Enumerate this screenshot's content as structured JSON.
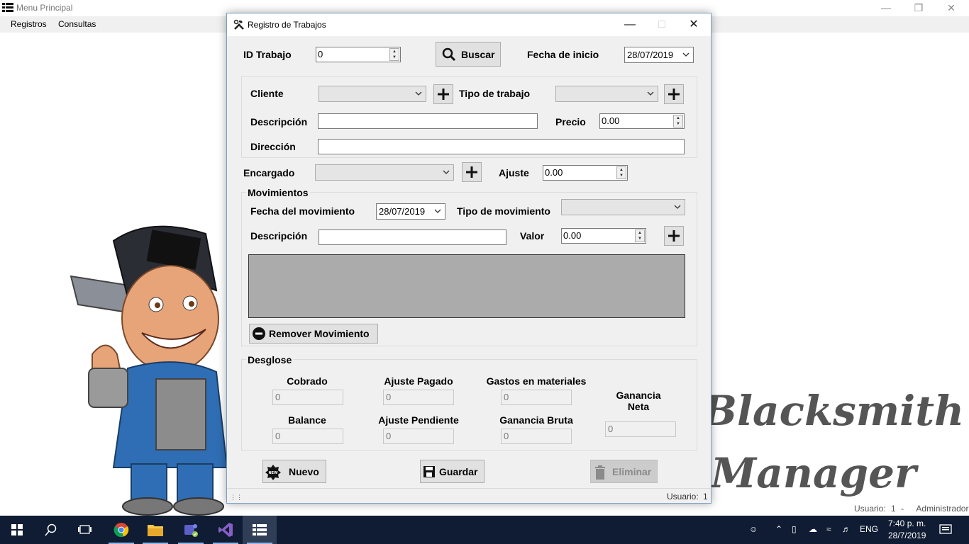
{
  "main_window": {
    "title": "Menu Principal",
    "menu": [
      "Registros",
      "Consultas"
    ],
    "brand_line1": "Blacksmith",
    "brand_line2": "Manager",
    "status": {
      "usuario_label": "Usuario:",
      "usuario_id": "1",
      "separator": "-",
      "role": "Administrador"
    }
  },
  "dialog": {
    "title": "Registro de Trabajos",
    "id_trabajo": {
      "label": "ID Trabajo",
      "value": "0"
    },
    "buscar_label": "Buscar",
    "fecha_inicio": {
      "label": "Fecha de inicio",
      "value": "28/07/2019"
    },
    "cliente": {
      "label": "Cliente",
      "value": ""
    },
    "tipo_trabajo": {
      "label": "Tipo de trabajo",
      "value": ""
    },
    "descripcion": {
      "label": "Descripción",
      "value": ""
    },
    "precio": {
      "label": "Precio",
      "value": "0.00"
    },
    "direccion": {
      "label": "Dirección",
      "value": ""
    },
    "encargado": {
      "label": "Encargado",
      "value": ""
    },
    "ajuste": {
      "label": "Ajuste",
      "value": "0.00"
    },
    "movimientos": {
      "title": "Movimientos",
      "fecha": {
        "label": "Fecha del movimiento",
        "value": "28/07/2019"
      },
      "tipo": {
        "label": "Tipo de movimiento",
        "value": ""
      },
      "descripcion": {
        "label": "Descripción",
        "value": ""
      },
      "valor": {
        "label": "Valor",
        "value": "0.00"
      },
      "remover_label": "Remover Movimiento"
    },
    "desglose": {
      "title": "Desglose",
      "cobrado": {
        "label": "Cobrado",
        "value": "0"
      },
      "ajuste_pagado": {
        "label": "Ajuste Pagado",
        "value": "0"
      },
      "gastos_materiales": {
        "label": "Gastos en materiales",
        "value": "0"
      },
      "ganancia_neta": {
        "label_line1": "Ganancia",
        "label_line2": "Neta",
        "value": "0"
      },
      "balance": {
        "label": "Balance",
        "value": "0"
      },
      "ajuste_pendiente": {
        "label": "Ajuste Pendiente",
        "value": "0"
      },
      "ganancia_bruta": {
        "label": "Ganancia Bruta",
        "value": "0"
      }
    },
    "buttons": {
      "nuevo": "Nuevo",
      "guardar": "Guardar",
      "eliminar": "Eliminar",
      "new_badge": "NEW"
    },
    "status": {
      "usuario_label": "Usuario:",
      "usuario_id": "1"
    }
  },
  "taskbar": {
    "apps": [
      "start-icon",
      "search-icon",
      "task-view-icon",
      "chrome-icon",
      "file-explorer-icon",
      "teams-icon",
      "visual-studio-icon",
      "app-menu-icon"
    ],
    "language": "ENG",
    "time": "7:40 p. m.",
    "date": "28/7/2019"
  },
  "colors": {
    "accent": "#0f1c33",
    "brand_text": "#555555",
    "grid": "#ababab"
  }
}
